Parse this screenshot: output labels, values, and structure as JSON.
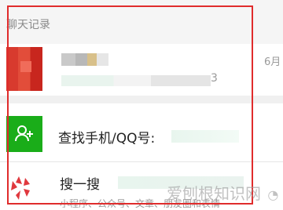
{
  "section": {
    "title": "聊天记录"
  },
  "chat": {
    "time": "6月",
    "preview_tail": "3"
  },
  "find": {
    "label": "查找手机/QQ号:"
  },
  "search": {
    "label": "搜一搜",
    "sub": "小程序、公众号、文章、朋友圈和表情"
  },
  "watermark": {
    "text": "爱刨根知识网"
  },
  "colors": {
    "highlight": "#e02c2c",
    "find_icon_bg": "#1aad19",
    "search_icon": "#e0383e"
  },
  "icons": {
    "find": "add-contact-icon",
    "search": "search-icon"
  }
}
